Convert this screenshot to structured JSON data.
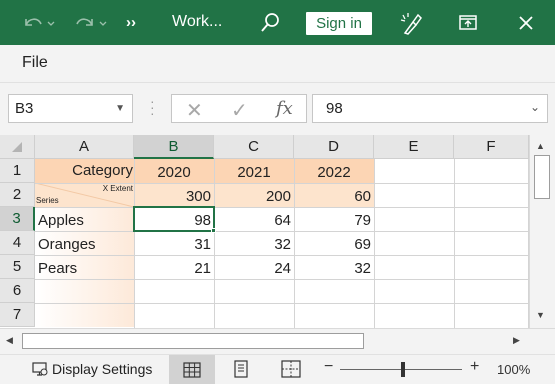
{
  "window": {
    "doc_title": "Work...",
    "sign_in_label": "Sign in",
    "icons": [
      "undo-icon",
      "redo-icon",
      "more-commands-icon",
      "search-icon",
      "ideas-icon",
      "restore-window-icon",
      "close-icon"
    ],
    "colors": {
      "title_bar": "#217346",
      "selected_header": "#217346",
      "category_fill": "#fcd5b4"
    }
  },
  "ribbon": {
    "file_tab": "File"
  },
  "formula_bar": {
    "name_box": "B3",
    "fx_label": "fx",
    "value": "98"
  },
  "sheet": {
    "columns": [
      "A",
      "B",
      "C",
      "D",
      "E",
      "F"
    ],
    "rows": [
      "1",
      "2",
      "3",
      "4",
      "5",
      "6",
      "7"
    ],
    "selected_column": "B",
    "selected_row": "3",
    "header_row": {
      "corner_label": "Category",
      "years": [
        "2020",
        "2021",
        "2022"
      ]
    },
    "extent_row": {
      "x_extent_label": "X Extent",
      "series_label": "Series",
      "values": [
        "300",
        "200",
        "60"
      ]
    },
    "data": [
      {
        "label": "Apples",
        "values": [
          "98",
          "64",
          "79"
        ]
      },
      {
        "label": "Oranges",
        "values": [
          "31",
          "32",
          "69"
        ]
      },
      {
        "label": "Pears",
        "values": [
          "21",
          "24",
          "32"
        ]
      }
    ]
  },
  "status_bar": {
    "display_settings": "Display Settings",
    "zoom_minus": "−",
    "zoom_plus": "+",
    "zoom_level": "100%"
  }
}
